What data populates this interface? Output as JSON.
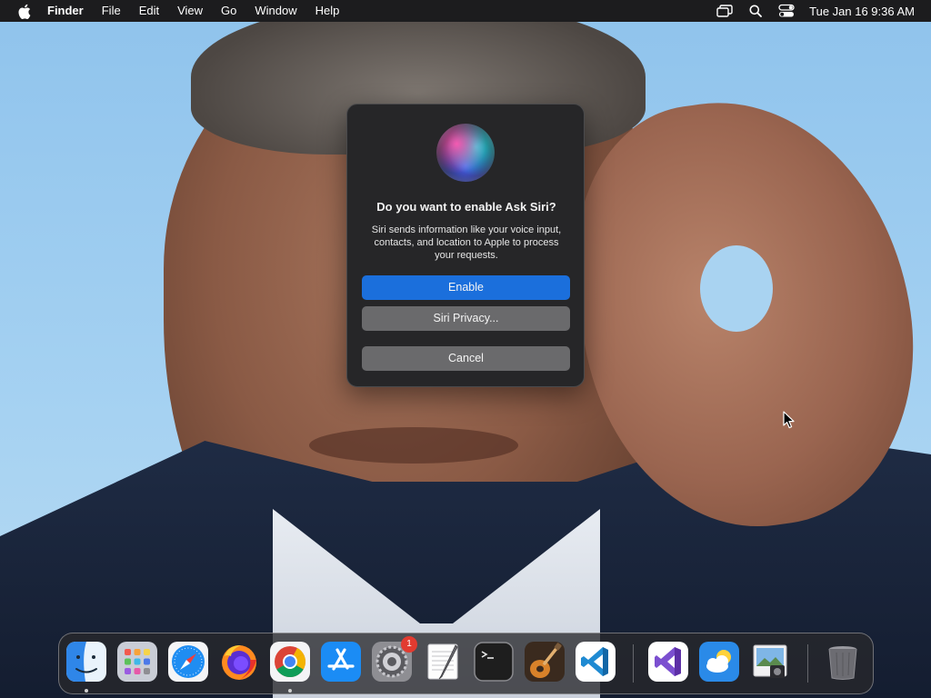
{
  "menubar": {
    "app_name": "Finder",
    "items": [
      "File",
      "Edit",
      "View",
      "Go",
      "Window",
      "Help"
    ],
    "status_icons": [
      "screen-mirroring-icon",
      "search-icon",
      "control-center-icon"
    ],
    "clock": "Tue Jan 16  9:36 AM"
  },
  "dialog": {
    "title": "Do you want to enable Ask Siri?",
    "body": "Siri sends information like your voice input, contacts, and location to Apple to process your requests.",
    "buttons": {
      "enable": "Enable",
      "privacy": "Siri Privacy...",
      "cancel": "Cancel"
    },
    "icon": "siri-icon"
  },
  "dock": {
    "apps": [
      {
        "name": "Finder",
        "icon": "finder-icon",
        "running": true
      },
      {
        "name": "Launchpad",
        "icon": "launchpad-icon",
        "running": false
      },
      {
        "name": "Safari",
        "icon": "safari-icon",
        "running": false
      },
      {
        "name": "Firefox",
        "icon": "firefox-icon",
        "running": false
      },
      {
        "name": "Google Chrome",
        "icon": "chrome-icon",
        "running": true
      },
      {
        "name": "App Store",
        "icon": "app-store-icon",
        "running": false
      },
      {
        "name": "System Settings",
        "icon": "system-settings-icon",
        "running": false,
        "badge": "1"
      },
      {
        "name": "TextEdit",
        "icon": "textedit-icon",
        "running": false
      },
      {
        "name": "Terminal",
        "icon": "terminal-icon",
        "running": false
      },
      {
        "name": "GarageBand",
        "icon": "garageband-icon",
        "running": false
      },
      {
        "name": "Visual Studio Code",
        "icon": "vscode-icon",
        "running": false
      },
      {
        "name": "Visual Studio",
        "icon": "visual-studio-icon",
        "running": false
      },
      {
        "name": "Weather",
        "icon": "weather-icon",
        "running": false
      },
      {
        "name": "Preview",
        "icon": "preview-icon",
        "running": false
      },
      {
        "name": "Trash",
        "icon": "trash-icon",
        "running": false
      }
    ]
  },
  "colors": {
    "accent": "#1b6fdc",
    "menubar_bg": "#1c1c1e",
    "dialog_bg": "#262628",
    "badge": "#e23b30"
  }
}
